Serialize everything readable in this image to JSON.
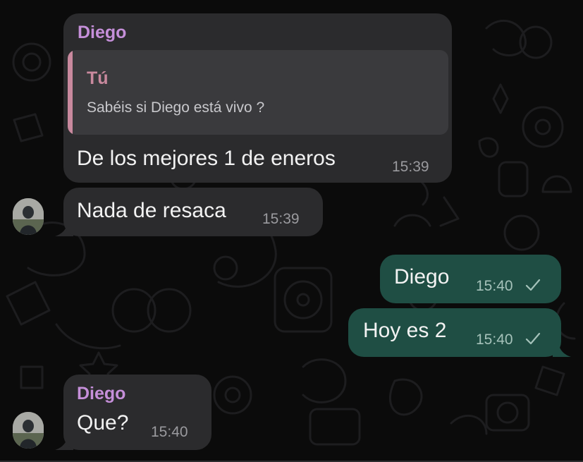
{
  "chat": {
    "messages": [
      {
        "sender": "Diego",
        "quote": {
          "author": "Tú",
          "text": "Sabéis si Diego está vivo ?"
        },
        "text": "De los mejores 1 de eneros",
        "time": "15:39"
      },
      {
        "text": "Nada de resaca",
        "time": "15:39"
      },
      {
        "text": "Diego",
        "time": "15:40",
        "status": "sent-check-icon"
      },
      {
        "text": "Hoy es 2",
        "time": "15:40",
        "status": "sent-check-icon"
      },
      {
        "sender": "Diego",
        "text": "Que?",
        "time": "15:40"
      }
    ]
  },
  "colors": {
    "background": "#0b0b0b",
    "incoming_bubble": "#2b2b2d",
    "outgoing_bubble": "#1f4e44",
    "sender_name": "#c58fd9",
    "quote_accent": "#c9899e"
  }
}
